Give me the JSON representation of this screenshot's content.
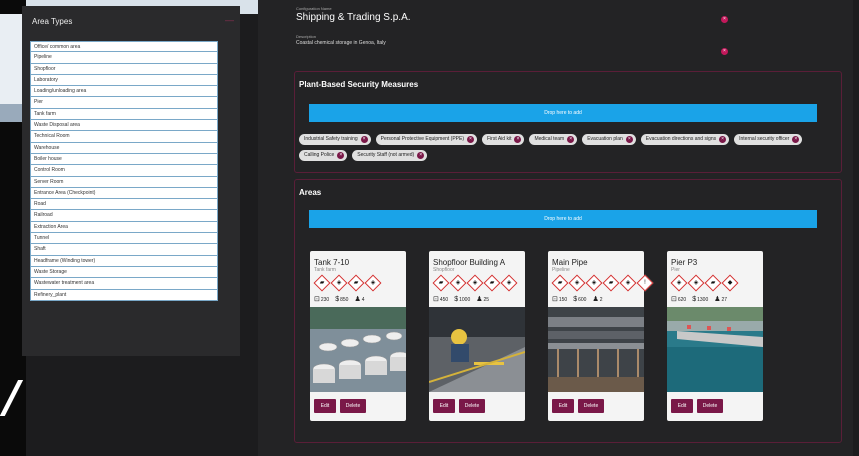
{
  "area_panel": {
    "title": "Area Types",
    "close": "—",
    "items": [
      "Office/ common area",
      "Pipeline",
      "Shopfloor",
      "Laboratory",
      "Loading/unloading area",
      "Pier",
      "Tank farm",
      "Waste Disposal area",
      "Technical Room",
      "Warehouse",
      "Boiler house",
      "Control Room",
      "Server Room",
      "Entrance Area (Checkpoint)",
      "Road",
      "Railroad",
      "Extraction Area",
      "Tunnel",
      "Shaft",
      "Headframe (Winding tower)",
      "Waste Storage",
      "Wastewater treatment area",
      "Refinery_plant"
    ]
  },
  "config": {
    "name_label": "Configuration Name",
    "name": "Shipping & Trading S.p.A.",
    "desc_label": "Description",
    "desc": "Coastal chemical storage in Genoa, Italy",
    "remove": "×"
  },
  "security": {
    "title": "Plant-Based Security Measures",
    "drop": "Drop here to add",
    "chips": [
      "Industrial Safety training",
      "Personal Protective Equipment (PPE)",
      "First Aid kit",
      "Medical team",
      "Evacuation plan",
      "Evacuation directions and signs",
      "Internal security officer",
      "Calling Police",
      "Security Staff (not armed)"
    ],
    "chip_remove": "×"
  },
  "areas": {
    "title": "Areas",
    "drop": "Drop here to add",
    "edit": "Edit",
    "delete": "Delete",
    "cards": [
      {
        "title": "Tank 7-10",
        "type": "Tank farm",
        "hazards": [
          "▰",
          "◈",
          "▰",
          "◈"
        ],
        "s1": "230",
        "s2": "850",
        "s3": "4"
      },
      {
        "title": "Shopfloor Building A",
        "type": "Shopfloor",
        "hazards": [
          "▰",
          "◈",
          "◈",
          "▰",
          "◈"
        ],
        "s1": "450",
        "s2": "1000",
        "s3": "25"
      },
      {
        "title": "Main Pipe",
        "type": "Pipeline",
        "hazards": [
          "▰",
          "◈",
          "◈",
          "▰",
          "◈",
          "!"
        ],
        "s1": "150",
        "s2": "600",
        "s3": "2"
      },
      {
        "title": "Pier P3",
        "type": "Pier",
        "hazards": [
          "◈",
          "◈",
          "▰",
          "◆"
        ],
        "s1": "620",
        "s2": "1300",
        "s3": "27"
      }
    ]
  }
}
